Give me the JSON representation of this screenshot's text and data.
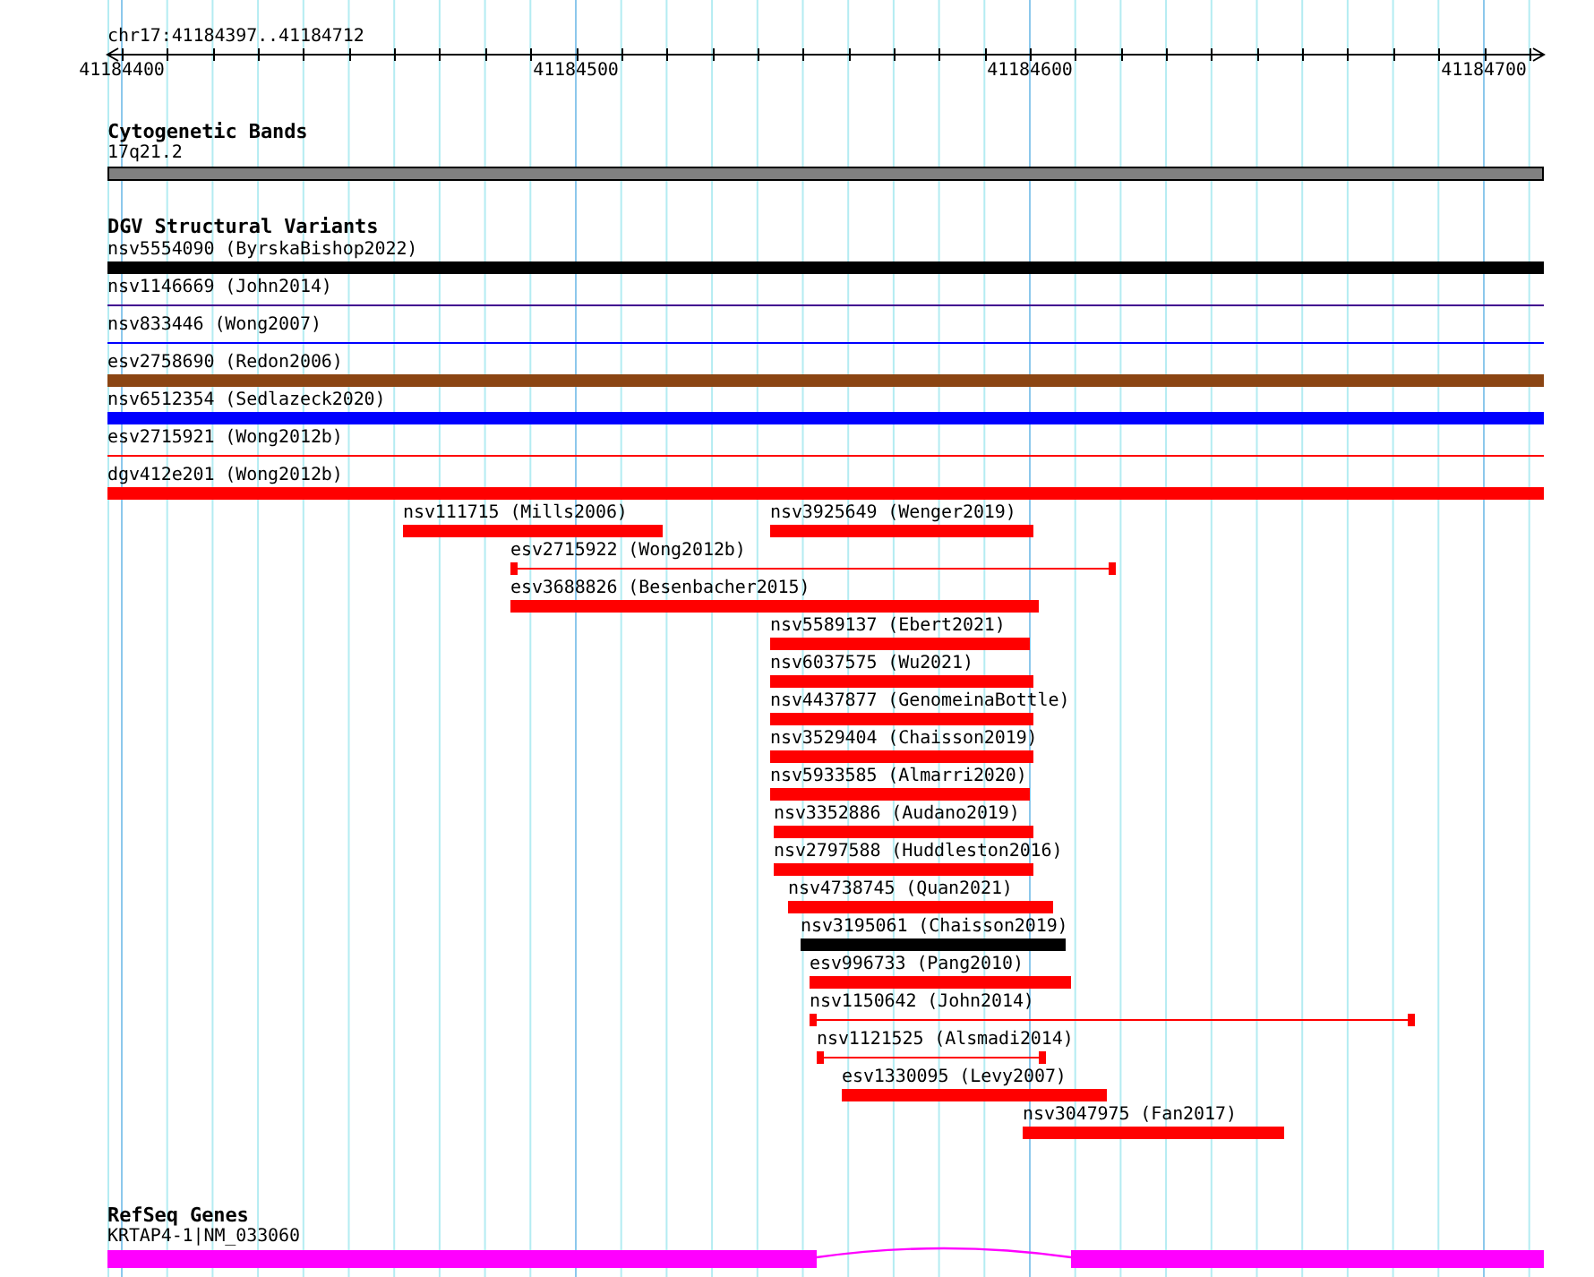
{
  "ruler": {
    "title": "chr17:41184397..41184712",
    "ticks": [
      "41184400",
      "41184500",
      "41184600",
      "41184700"
    ]
  },
  "tracks": [
    {
      "title": "Cytogenetic Bands",
      "features": [
        {
          "label": "17q21.2",
          "kind": "band",
          "color": "#808080"
        }
      ]
    },
    {
      "title": "DGV Structural Variants",
      "features": [
        {
          "label": "nsv5554090 (ByrskaBishop2022)",
          "kind": "bar",
          "color": "#000000"
        },
        {
          "label": "nsv1146669 (John2014)",
          "kind": "line",
          "color": "#400090"
        },
        {
          "label": "nsv833446 (Wong2007)",
          "kind": "line",
          "color": "#0000ff"
        },
        {
          "label": "esv2758690 (Redon2006)",
          "kind": "bar",
          "color": "#8b4513"
        },
        {
          "label": "nsv6512354 (Sedlazeck2020)",
          "kind": "bar",
          "color": "#0000ff"
        },
        {
          "label": "esv2715921 (Wong2012b)",
          "kind": "line",
          "color": "#ff0000"
        },
        {
          "label": "dgv412e201 (Wong2012b)",
          "kind": "bar",
          "color": "#ff0000"
        },
        {
          "label": "nsv111715 (Mills2006)",
          "kind": "bar",
          "color": "#ff0000"
        },
        {
          "label": "nsv3925649 (Wenger2019)",
          "kind": "bar",
          "color": "#ff0000"
        },
        {
          "label": "esv2715922 (Wong2012b)",
          "kind": "line",
          "color": "#ff0000"
        },
        {
          "label": "esv3688826 (Besenbacher2015)",
          "kind": "bar",
          "color": "#ff0000"
        },
        {
          "label": "nsv5589137 (Ebert2021)",
          "kind": "bar",
          "color": "#ff0000"
        },
        {
          "label": "nsv6037575 (Wu2021)",
          "kind": "bar",
          "color": "#ff0000"
        },
        {
          "label": "nsv4437877 (GenomeinaBottle)",
          "kind": "bar",
          "color": "#ff0000"
        },
        {
          "label": "nsv3529404 (Chaisson2019)",
          "kind": "bar",
          "color": "#ff0000"
        },
        {
          "label": "nsv5933585 (Almarri2020)",
          "kind": "bar",
          "color": "#ff0000"
        },
        {
          "label": "nsv3352886 (Audano2019)",
          "kind": "bar",
          "color": "#ff0000"
        },
        {
          "label": "nsv2797588 (Huddleston2016)",
          "kind": "bar",
          "color": "#ff0000"
        },
        {
          "label": "nsv4738745 (Quan2021)",
          "kind": "bar",
          "color": "#ff0000"
        },
        {
          "label": "nsv3195061 (Chaisson2019)",
          "kind": "bar",
          "color": "#000000"
        },
        {
          "label": "esv996733 (Pang2010)",
          "kind": "bar",
          "color": "#ff0000"
        },
        {
          "label": "nsv1150642 (John2014)",
          "kind": "line",
          "color": "#ff0000"
        },
        {
          "label": "nsv1121525 (Alsmadi2014)",
          "kind": "line",
          "color": "#ff0000"
        },
        {
          "label": "esv1330095 (Levy2007)",
          "kind": "bar",
          "color": "#ff0000"
        },
        {
          "label": "nsv3047975 (Fan2017)",
          "kind": "bar",
          "color": "#ff0000"
        }
      ]
    },
    {
      "title": "RefSeq Genes",
      "features": [
        {
          "label": "KRTAP4-1|NM_033060",
          "kind": "gene",
          "color": "#ff00ff"
        }
      ]
    }
  ]
}
